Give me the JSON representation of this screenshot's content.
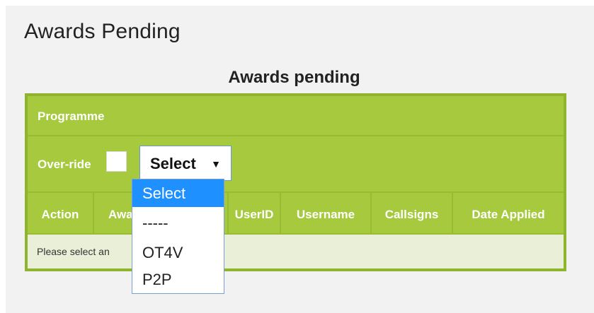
{
  "page": {
    "title": "Awards Pending"
  },
  "table": {
    "caption": "Awards pending",
    "programme_label": "Programme",
    "override_label": "Over-ride",
    "select_value": "Select",
    "columns": [
      "Action",
      "Award",
      "UserID",
      "Username",
      "Callsigns",
      "Date Applied"
    ],
    "empty_message": "Please select an"
  },
  "dropdown": {
    "options": [
      "Select",
      "-----",
      "OT4V",
      "P2P"
    ],
    "highlighted": "Select"
  },
  "colors": {
    "table_green": "#a6c93e",
    "row_light": "#eaf0d8",
    "highlight_blue": "#1e90ff",
    "panel_bg": "#f2f2f2"
  }
}
